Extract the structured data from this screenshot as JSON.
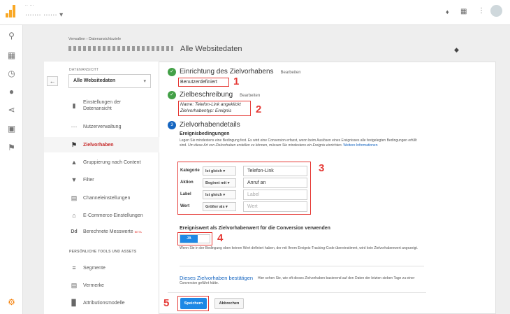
{
  "topbar": {
    "account_label": "∙∙ ∙∙∙",
    "property_label": "∙∙∙∙∙∙∙ ∙∙∙∙∙∙ ▾"
  },
  "breadcrumb": "Verwalten › Datenansichtsziele",
  "property_title": "Alle Websitedaten",
  "left": {
    "section_label": "DATENANSICHT",
    "view_select": "Alle Websitedaten",
    "items": [
      {
        "label": "Einstellungen der Datenansicht",
        "icon": "document-icon"
      },
      {
        "label": "Nutzerverwaltung",
        "icon": "users-icon"
      },
      {
        "label": "Zielvorhaben",
        "icon": "flag-icon"
      },
      {
        "label": "Gruppierung nach Content",
        "icon": "walk-icon"
      },
      {
        "label": "Filter",
        "icon": "filter-icon"
      },
      {
        "label": "Channeleinstellungen",
        "icon": "channel-icon"
      },
      {
        "label": "E-Commerce-Einstellungen",
        "icon": "cart-icon"
      },
      {
        "label": "Berechnete Messwerte",
        "icon": "dd-icon",
        "badge": "BETA"
      }
    ],
    "tools_label": "PERSÖNLICHE TOOLS UND ASSETS",
    "tools": [
      {
        "label": "Segmente",
        "icon": "segments-icon"
      },
      {
        "label": "Vermerke",
        "icon": "notes-icon"
      },
      {
        "label": "Attributionsmodelle",
        "icon": "bars-icon"
      }
    ]
  },
  "steps": {
    "s1": {
      "title": "Einrichtung des Zielvorhabens",
      "edit": "Bearbeiten",
      "value": "Benutzerdefiniert",
      "marker": "1"
    },
    "s2": {
      "title": "Zielbeschreibung",
      "edit": "Bearbeiten",
      "name_line": "Name: Telefon-Link angeklickt",
      "type_line": "Zielvorhabentyp: Ereignis",
      "marker": "2"
    },
    "s3": {
      "number": "3",
      "title": "Zielvorhabendetails",
      "conditions_heading": "Ereignisbedingungen",
      "conditions_desc": "Legen Sie mindestens eine Bedingung fest. Es wird eine Conversion erfasst, wenn beim Auslösen eines Ereignisses alle festgelegten Bedingungen erfüllt sind.",
      "conditions_desc_italic": "Um diese Art von Zielvorhaben erstellen zu können, müssen Sie mindestens ein Ereignis einrichten.",
      "more_info": "Weitere Informationen",
      "marker": "3",
      "rows": [
        {
          "key": "Kategorie",
          "op": "Ist gleich",
          "value": "Telefon-Link",
          "placeholder": false
        },
        {
          "key": "Aktion",
          "op": "Beginnt mit",
          "value": "Anruf an",
          "placeholder": false
        },
        {
          "key": "Label",
          "op": "Ist gleich",
          "value": "Label",
          "placeholder": true
        },
        {
          "key": "Wert",
          "op": "Größer als",
          "value": "Wert",
          "placeholder": true
        }
      ],
      "event_value_heading": "Ereigniswert als Zielvorhabenwert für die Conversion verwenden",
      "toggle_label": "JA",
      "marker4": "4",
      "event_value_desc": "Wenn Sie in der Bedingung oben keinen Wert definiert haben, der mit Ihrem Ereignis-Tracking-Code übereinstimmt, wird kein Zielvorhabenwert angezeigt.",
      "verify_link": "Dieses Zielvorhaben bestätigen",
      "verify_desc": "Hier sehen Sie, wie oft dieses Zielvorhaben basierend auf den Daten der letzten sieben Tage zu einer Conversion geführt hätte."
    }
  },
  "actions": {
    "save": "Speichern",
    "cancel": "Abbrechen",
    "marker": "5"
  },
  "colors": {
    "accent": "#1e88e5",
    "highlight": "#e53935",
    "success": "#43a047",
    "active_nav": "#c62828"
  }
}
